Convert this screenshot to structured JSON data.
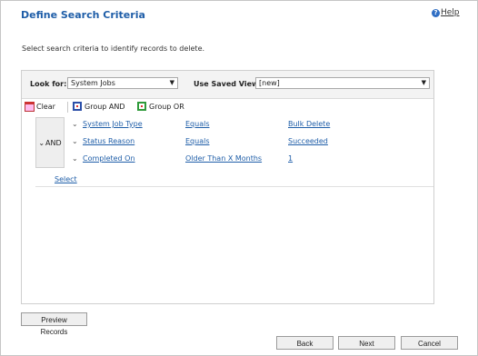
{
  "header": {
    "title": "Define Search Criteria",
    "help_label": "Help",
    "help_icon": "help-icon"
  },
  "instructions": "Select search criteria to identify records to delete.",
  "filters": {
    "look_for_label": "Look for:",
    "look_for_value": "System Jobs",
    "saved_view_label": "Use Saved View:",
    "saved_view_value": "[new]"
  },
  "toolbar": {
    "clear_label": "Clear",
    "group_and_label": "Group AND",
    "group_or_label": "Group OR"
  },
  "criteria": {
    "group_operator": "AND",
    "rows": [
      {
        "field": "System Job Type",
        "operator": "Equals",
        "value": "Bulk Delete"
      },
      {
        "field": "Status Reason",
        "operator": "Equals",
        "value": "Succeeded"
      },
      {
        "field": "Completed On",
        "operator": "Older Than X Months",
        "value": "1"
      }
    ],
    "select_label": "Select"
  },
  "buttons": {
    "preview": "Preview Records",
    "back": "Back",
    "next": "Next",
    "cancel": "Cancel"
  },
  "colors": {
    "title": "#1f5ea8",
    "link": "#1f5ea8",
    "group_and": "#2b4fa8",
    "group_or": "#2f9a3a"
  }
}
